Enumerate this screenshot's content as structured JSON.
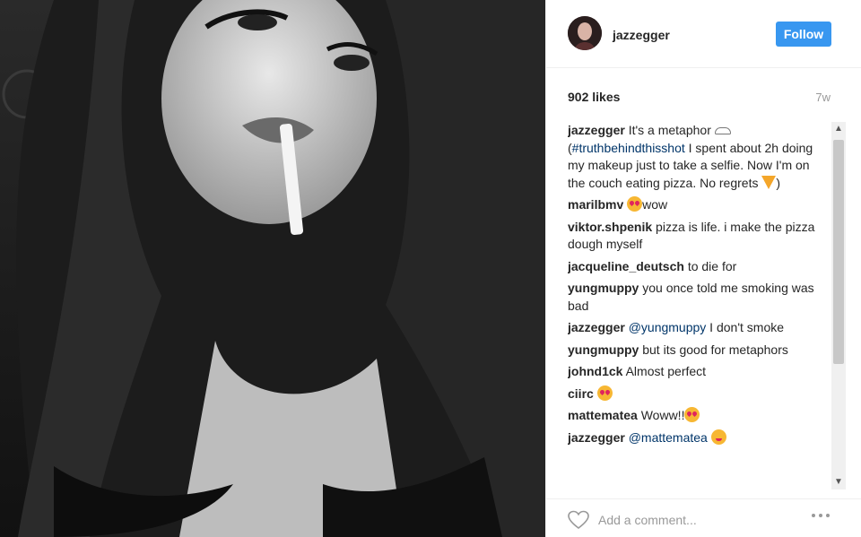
{
  "post": {
    "username": "jazzegger",
    "follow_label": "Follow",
    "likes": "902 likes",
    "time": "7w",
    "comments": [
      {
        "author": "jazzegger",
        "segments": [
          {
            "t": "text",
            "v": " It's a metaphor "
          },
          {
            "t": "emoji",
            "v": "cloud"
          },
          {
            "t": "text",
            "v": " ("
          },
          {
            "t": "link",
            "v": "#truthbehindthisshot"
          },
          {
            "t": "text",
            "v": " I spent about 2h doing my makeup just to take a selfie. Now I'm on the couch eating pizza. No regrets "
          },
          {
            "t": "emoji",
            "v": "pizza"
          },
          {
            "t": "text",
            "v": ")"
          }
        ]
      },
      {
        "author": "marilbmv",
        "segments": [
          {
            "t": "text",
            "v": " "
          },
          {
            "t": "emoji",
            "v": "heart-eyes"
          },
          {
            "t": "text",
            "v": "wow"
          }
        ]
      },
      {
        "author": "viktor.shpenik",
        "segments": [
          {
            "t": "text",
            "v": " pizza is life. i make the pizza dough myself"
          }
        ]
      },
      {
        "author": "jacqueline_deutsch",
        "segments": [
          {
            "t": "text",
            "v": " to die for"
          }
        ]
      },
      {
        "author": "yungmuppy",
        "segments": [
          {
            "t": "text",
            "v": " you once told me smoking was bad"
          }
        ]
      },
      {
        "author": "jazzegger",
        "segments": [
          {
            "t": "text",
            "v": " "
          },
          {
            "t": "link",
            "v": "@yungmuppy"
          },
          {
            "t": "text",
            "v": " I don't smoke"
          }
        ]
      },
      {
        "author": "yungmuppy",
        "segments": [
          {
            "t": "text",
            "v": " but its good for metaphors"
          }
        ]
      },
      {
        "author": "johnd1ck",
        "segments": [
          {
            "t": "text",
            "v": " Almost perfect"
          }
        ]
      },
      {
        "author": "ciirc",
        "segments": [
          {
            "t": "text",
            "v": " "
          },
          {
            "t": "emoji",
            "v": "heart-eyes"
          }
        ]
      },
      {
        "author": "mattematea",
        "segments": [
          {
            "t": "text",
            "v": " Woww!!"
          },
          {
            "t": "emoji",
            "v": "heart-eyes"
          }
        ]
      },
      {
        "author": "jazzegger",
        "segments": [
          {
            "t": "text",
            "v": " "
          },
          {
            "t": "link",
            "v": "@mattematea"
          },
          {
            "t": "text",
            "v": " "
          },
          {
            "t": "emoji",
            "v": "wink"
          }
        ]
      }
    ]
  },
  "comment_box": {
    "placeholder": "Add a comment..."
  },
  "icons": {
    "like": "heart-icon",
    "more": "more-options-icon",
    "scroll_up": "chevron-up-icon",
    "scroll_down": "chevron-down-icon"
  },
  "colors": {
    "follow_button": "#3897f0",
    "link": "#003569",
    "muted": "#999999"
  }
}
